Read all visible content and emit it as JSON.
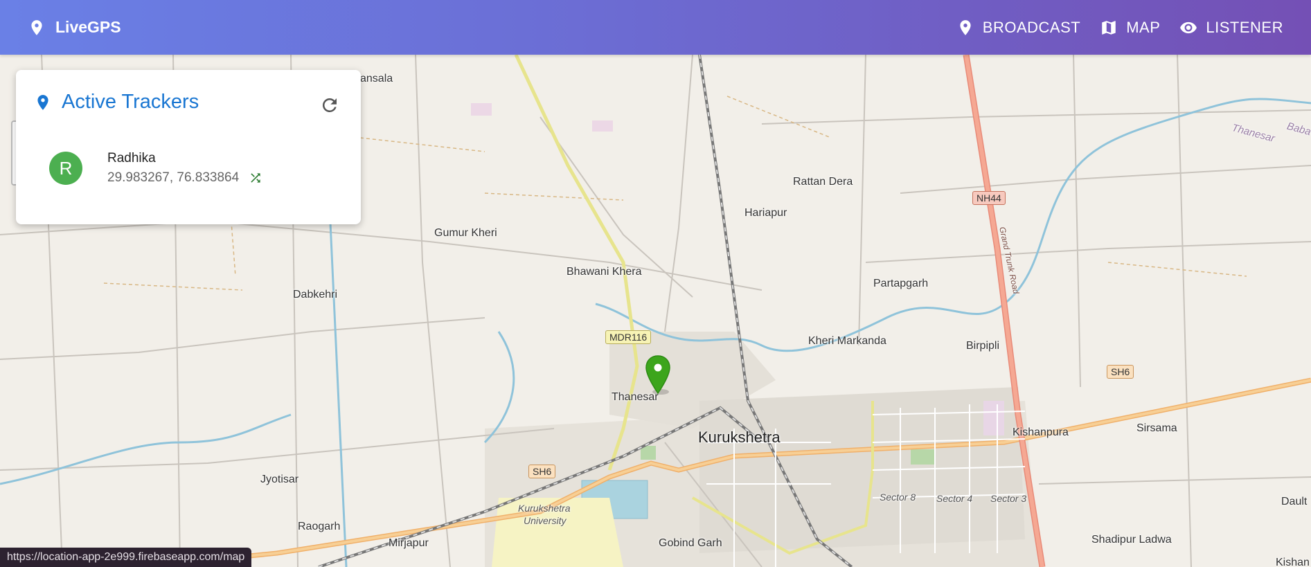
{
  "app": {
    "brand": "LiveGPS",
    "nav": [
      {
        "label": "BROADCAST",
        "icon": "location-pin-icon"
      },
      {
        "label": "MAP",
        "icon": "map-icon"
      },
      {
        "label": "LISTENER",
        "icon": "eye-icon"
      }
    ]
  },
  "panel": {
    "title": "Active Trackers",
    "refresh_icon": "refresh-icon",
    "trackers": [
      {
        "initial": "R",
        "name": "Radhika",
        "coords": "29.983267, 76.833864",
        "status_icon": "shuffle-icon",
        "avatar_color": "#4caf50"
      }
    ]
  },
  "map": {
    "places": {
      "jansala": "Jansala",
      "rattan_dera": "Rattan Dera",
      "hariapur": "Hariapur",
      "gumur_kheri": "Gumur Kheri",
      "bhawani_khera": "Bhawani Khera",
      "partapgarh": "Partapgarh",
      "dabkehri": "Dabkehri",
      "kheri_markanda": "Kheri Markanda",
      "birpipli": "Birpipli",
      "thanesar": "Thanesar",
      "kurukshetra": "Kurukshetra",
      "kishanpura": "Kishanpura",
      "sirsama": "Sirsama",
      "jyotisar": "Jyotisar",
      "raogarh": "Raogarh",
      "mirjapur": "Mirjapur",
      "gobind_garh": "Gobind Garh",
      "shadipur_ladwa": "Shadipur Ladwa",
      "dault": "Dault",
      "kishan": "Kishan",
      "ku_line1": "Kurukshetra",
      "ku_line2": "University",
      "sector8": "Sector 8",
      "sector4": "Sector 4",
      "sector3": "Sector 3",
      "thanesar_river": "Thanesar",
      "baba": "Baba"
    },
    "shields": {
      "nh44": "NH44",
      "mdr116": "MDR116",
      "sh6_a": "SH6",
      "sh6_b": "SH6"
    },
    "grand_trunk_road": "Grand Trunk Road"
  },
  "statusbar": {
    "url": "https://location-app-2e999.firebaseapp.com/map"
  },
  "colors": {
    "accent": "#1976d2",
    "header_start": "#6a80e6",
    "header_end": "#7450b5",
    "marker": "#3ca51c"
  }
}
